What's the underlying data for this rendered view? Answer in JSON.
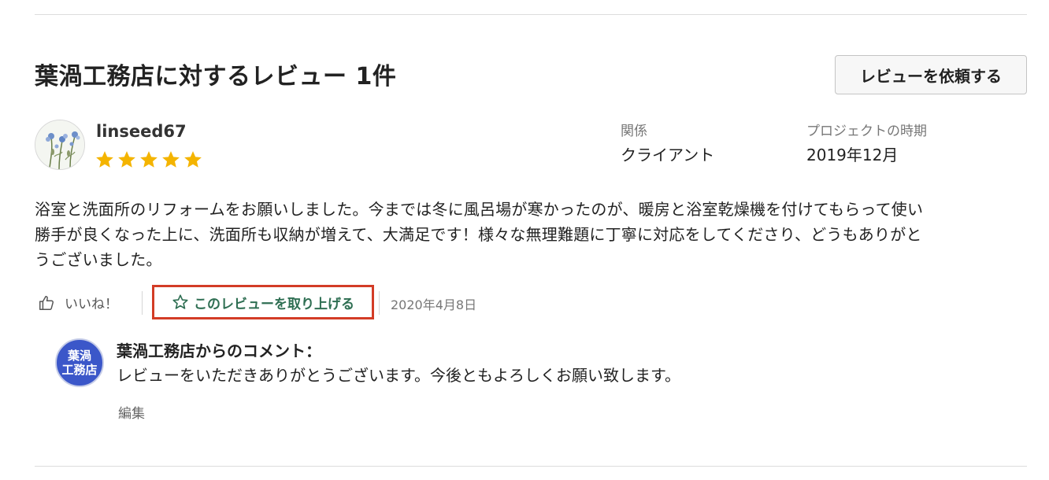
{
  "review_section": {
    "title": "葉渦工務店に対するレビュー 1件",
    "request_button_label": "レビューを依頼する"
  },
  "review": {
    "username": "linseed67",
    "rating": 5,
    "relation_label": "関係",
    "relation_value": "クライアント",
    "period_label": "プロジェクトの時期",
    "period_value": "2019年12月",
    "body_lines": [
      "浴室と洗面所のリフォームをお願いしました。今までは冬に風呂場が寒かったのが、暖房と浴室乾燥機を付けてもらって使い",
      "勝手が良くなった上に、洗面所も収納が増えて、大満足です！様々な無理難題に丁寧に対応をしてくださり、どうもありがと",
      "うございました。"
    ],
    "like_label": "いいね！",
    "feature_label": "このレビューを取り上げる",
    "date": "2020年4月8日"
  },
  "reply": {
    "avatar_lines": [
      "葉渦",
      "工務店"
    ],
    "heading": "葉渦工務店からのコメント：",
    "text": "レビューをいただきありがとうございます。今後ともよろしくお願い致します。",
    "edit_label": "編集"
  },
  "colors": {
    "star": "#f4b400",
    "feature_text": "#2f6f53",
    "highlight_border": "#d33c26",
    "reply_avatar_bg": "#3b57c9"
  },
  "icons": {
    "like": "thumbs-up-icon",
    "feature": "star-outline-icon",
    "rating": "star-icon"
  }
}
